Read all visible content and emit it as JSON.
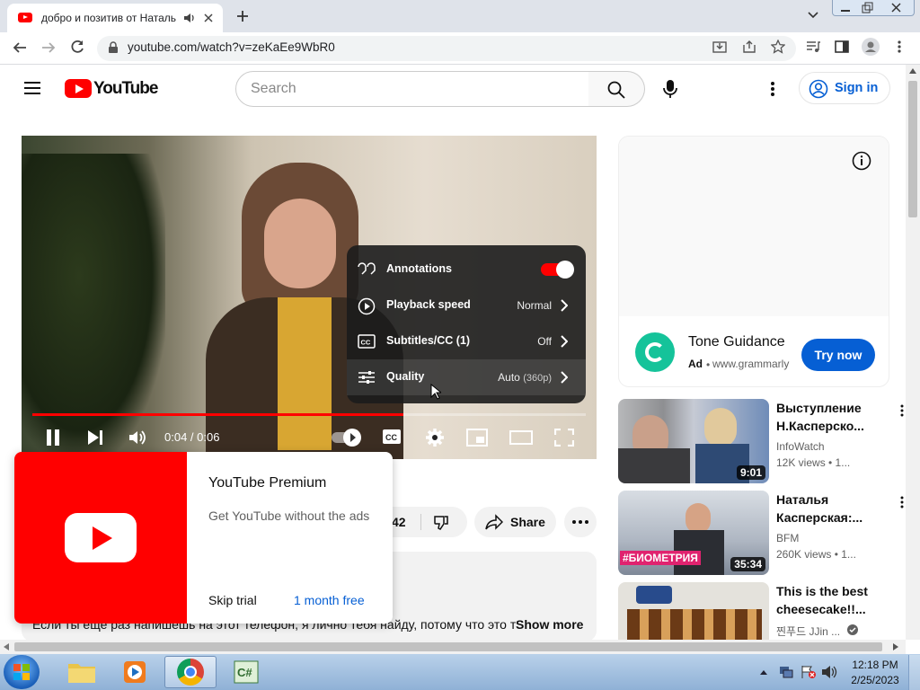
{
  "browser": {
    "tab_title": "добро и позитив от Натальи",
    "url": "youtube.com/watch?v=zeKaEe9WbR0"
  },
  "masthead": {
    "logo_text": "YouTube",
    "search_placeholder": "Search",
    "signin_label": "Sign in"
  },
  "player": {
    "time": "0:04 / 0:06",
    "progress": 0.67,
    "settings_menu": [
      {
        "label": "Annotations",
        "value": "",
        "toggle": true
      },
      {
        "label": "Playback speed",
        "value": "Normal"
      },
      {
        "label": "Subtitles/CC (1)",
        "value": "Off"
      },
      {
        "label": "Quality",
        "value": "Auto",
        "value_sub": "(360p)"
      }
    ]
  },
  "actions": {
    "like_count": "42",
    "share_label": "Share"
  },
  "description": {
    "text": "Если ты еще раз напишешь на этот телефон, я лично тебя найду, потому что это т",
    "show_more": "Show more"
  },
  "ad": {
    "title": "Tone Guidance",
    "badge": "Ad",
    "domain": "www.grammarly",
    "cta": "Try now",
    "brand_color": "#15c39a"
  },
  "related": [
    {
      "title": "Выступление Н.Касперско...",
      "channel": "InfoWatch",
      "meta": "12K views • 1...",
      "duration": "9:01"
    },
    {
      "title": "Наталья Касперская:...",
      "channel": "BFM",
      "meta": "260K views • 1...",
      "duration": "35:34",
      "banner": "#БИОМЕТРИЯ"
    },
    {
      "title": "This is the best cheesecake!!...",
      "channel": "찐푸드 JJin ...",
      "meta": "",
      "duration": ""
    }
  ],
  "premium_popup": {
    "title": "YouTube Premium",
    "subtitle": "Get YouTube without the ads",
    "skip": "Skip trial",
    "cta": "1 month free"
  },
  "taskbar": {
    "time": "12:18 PM",
    "date": "2/25/2023"
  }
}
